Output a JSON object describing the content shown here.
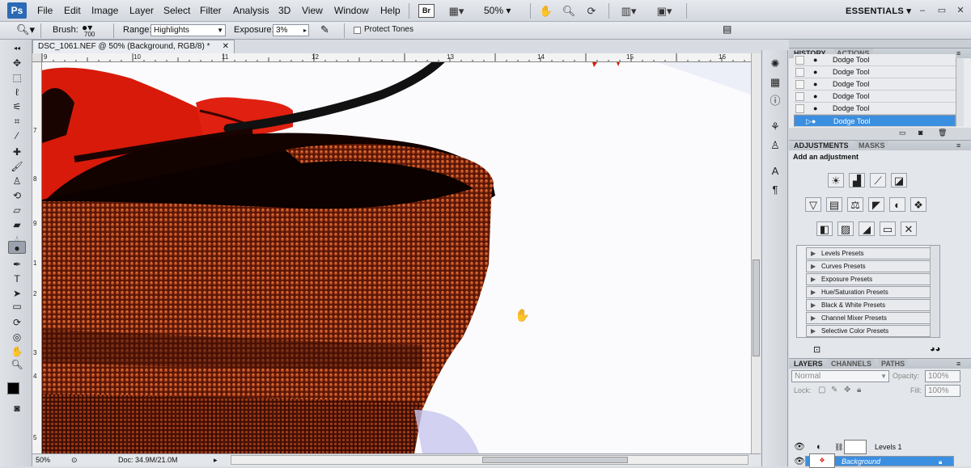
{
  "app": {
    "logo": "Ps"
  },
  "menubar": {
    "items": [
      "File",
      "Edit",
      "Image",
      "Layer",
      "Select",
      "Filter",
      "Analysis",
      "3D",
      "View",
      "Window",
      "Help"
    ],
    "bridge_label": "Br",
    "zoom": "50%",
    "workspace": "ESSENTIALS"
  },
  "options": {
    "brush_label": "Brush:",
    "brush_size": "700",
    "range_label": "Range:",
    "range_value": "Highlights",
    "exposure_label": "Exposure:",
    "exposure_value": "3%",
    "protect_tones": "Protect Tones"
  },
  "document": {
    "tab_title": "DSC_1061.NEF @ 50% (Background, RGB/8) *",
    "ruler_h": [
      "9",
      "10",
      "11",
      "12",
      "13",
      "14",
      "15",
      "16"
    ],
    "ruler_v": [
      "7",
      "8",
      "9",
      "1",
      "2",
      "3",
      "4",
      "5"
    ]
  },
  "status": {
    "zoom": "50%",
    "doc": "Doc: 34.9M/21.0M"
  },
  "history": {
    "tab_active": "HISTORY",
    "tab_inactive": "ACTIONS",
    "rows": [
      "Dodge Tool",
      "Dodge Tool",
      "Dodge Tool",
      "Dodge Tool",
      "Dodge Tool",
      "Dodge Tool"
    ]
  },
  "adjustments": {
    "tab_active": "ADJUSTMENTS",
    "tab_inactive": "MASKS",
    "heading": "Add an adjustment",
    "presets": [
      "Levels Presets",
      "Curves Presets",
      "Exposure Presets",
      "Hue/Saturation Presets",
      "Black & White Presets",
      "Channel Mixer Presets",
      "Selective Color Presets"
    ]
  },
  "layers": {
    "tab_active": "LAYERS",
    "tab_channels": "CHANNELS",
    "tab_paths": "PATHS",
    "blend_mode": "Normal",
    "opacity_label": "Opacity:",
    "opacity_value": "100%",
    "lock_label": "Lock:",
    "fill_label": "Fill:",
    "fill_value": "100%",
    "rows": [
      {
        "name": "Levels 1"
      },
      {
        "name": "Background"
      }
    ]
  },
  "colors": {
    "accent": "#3b8fe0",
    "basket": "#8a2a10",
    "red_shirt": "#d81a0a"
  }
}
